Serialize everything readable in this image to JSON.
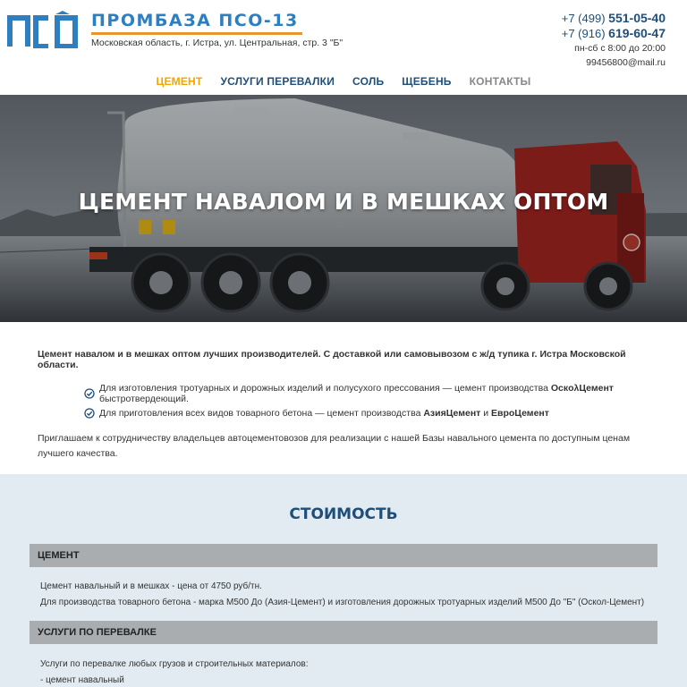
{
  "header": {
    "logo_mark": "ПСО",
    "logo_name": "ПРОМБАЗА ПСО-13",
    "address": "Московская область, г. Истра, ул. Центральная, стр. 3 \"Б\"",
    "phones": [
      {
        "code": "+7 (499)",
        "number": "551-05-40"
      },
      {
        "code": "+7 (916)",
        "number": "619-60-47"
      }
    ],
    "hours": "пн-сб с 8:00 до 20:00",
    "email": "99456800@mail.ru"
  },
  "nav": {
    "items": [
      {
        "label": "ЦЕМЕНТ",
        "state": "active"
      },
      {
        "label": "УСЛУГИ ПЕРЕВАЛКИ",
        "state": "normal"
      },
      {
        "label": "СОЛЬ",
        "state": "normal"
      },
      {
        "label": "ЩЕБЕНЬ",
        "state": "normal"
      },
      {
        "label": "КОНТАКТЫ",
        "state": "muted"
      }
    ]
  },
  "hero": {
    "title": "ЦЕМЕНТ НАВАЛОМ И В МЕШКАХ ОПТОМ"
  },
  "intro": {
    "lead": "Цемент навалом и в мешках оптом лучших производителей. С доставкой или самовывозом с ж/д тупика г. Истра Московской области.",
    "features": [
      {
        "text": "Для изготовления тротуарных и дорожных изделий и полусухого прессования — цемент производства ",
        "brand1": "ОскολЦемент",
        "sep": "",
        "brand2": "",
        "tail": " быстротвердеющий."
      },
      {
        "text": "Для приготовления всех видов товарного бетона — цемент производства ",
        "brand1": "АзияЦемент",
        "sep": " и ",
        "brand2": "ЕвроЦемент",
        "tail": ""
      }
    ],
    "invite": "Приглашаем к сотрудничеству владельцев автоцементовозов для реализации с нашей Базы навального цемента по доступным ценам лучшего качества."
  },
  "pricing": {
    "title": "СТОИМОСТЬ",
    "sections": [
      {
        "name": "ЦЕМЕНТ",
        "lines": [
          "Цемент навальный и в мешках - цена от 4750 руб/тн.",
          "Для производства товарного бетона - марка М500 До (Азия-Цемент) и изготовления дорожных тротуарных изделий М500 До \"Б\" (Оскол-Цемент)"
        ]
      },
      {
        "name": "УСЛУГИ ПО ПЕРЕВАЛКЕ",
        "lines": [
          "Услуги по перевалке любых грузов и строительных материалов:",
          "- цемент навальный"
        ]
      }
    ]
  },
  "colors": {
    "brand_blue": "#2d7fc1",
    "nav_blue": "#1f4e79",
    "accent_orange": "#f0a500",
    "pricing_bg": "#e1ebf1",
    "category_bar": "#a9adb0"
  },
  "icons": {
    "feature_bullet": "check-circle-icon"
  }
}
